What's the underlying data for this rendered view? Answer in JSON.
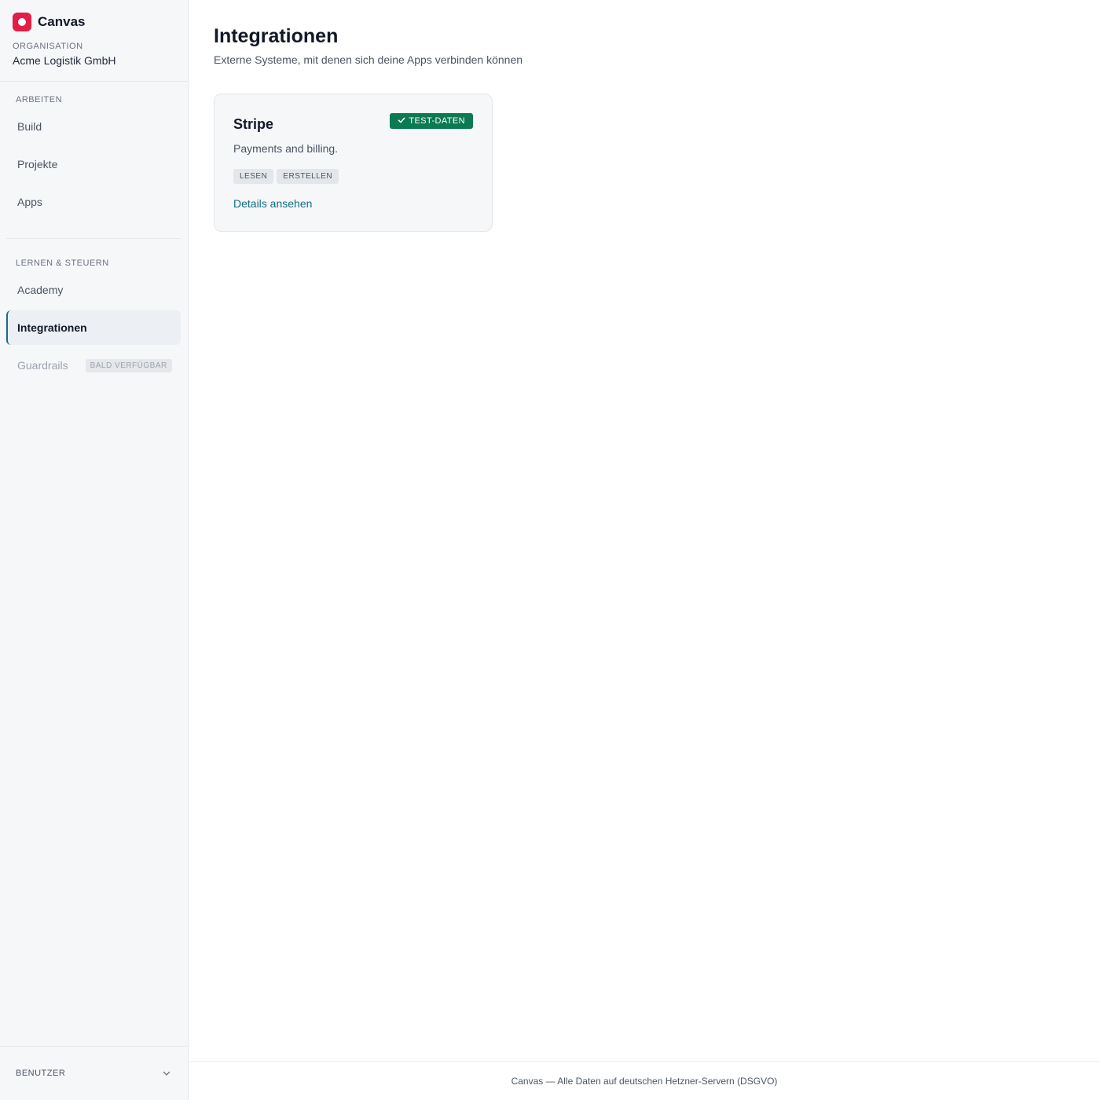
{
  "brand": {
    "name": "Canvas",
    "logo_color": "#e11d48"
  },
  "organisation": {
    "label": "ORGANISATION",
    "name": "Acme Logistik GmbH"
  },
  "sidebar": {
    "sections": [
      {
        "label": "ARBEITEN",
        "items": [
          {
            "label": "Build"
          },
          {
            "label": "Projekte"
          },
          {
            "label": "Apps"
          }
        ]
      },
      {
        "label": "LERNEN & STEUERN",
        "items": [
          {
            "label": "Academy"
          },
          {
            "label": "Integrationen",
            "active": true
          },
          {
            "label": "Guardrails",
            "disabled": true,
            "badge": "BALD VERFÜGBAR"
          }
        ]
      }
    ],
    "footer": {
      "label": "BENUTZER",
      "icon": "chevron-down-icon"
    }
  },
  "page": {
    "title": "Integrationen",
    "subtitle": "Externe Systeme, mit denen sich deine Apps verbinden können"
  },
  "integrations": [
    {
      "name": "Stripe",
      "status": {
        "icon": "check-icon",
        "label": "TEST-DATEN",
        "color": "#0b7a53"
      },
      "description": "Payments and billing.",
      "permissions": [
        "LESEN",
        "ERSTELLEN"
      ],
      "link_label": "Details ansehen"
    }
  ],
  "footer": {
    "text": "Canvas — Alle Daten auf deutschen Hetzner-Servern (DSGVO)"
  },
  "colors": {
    "accent": "#0f6f86",
    "success": "#0b7a53"
  }
}
